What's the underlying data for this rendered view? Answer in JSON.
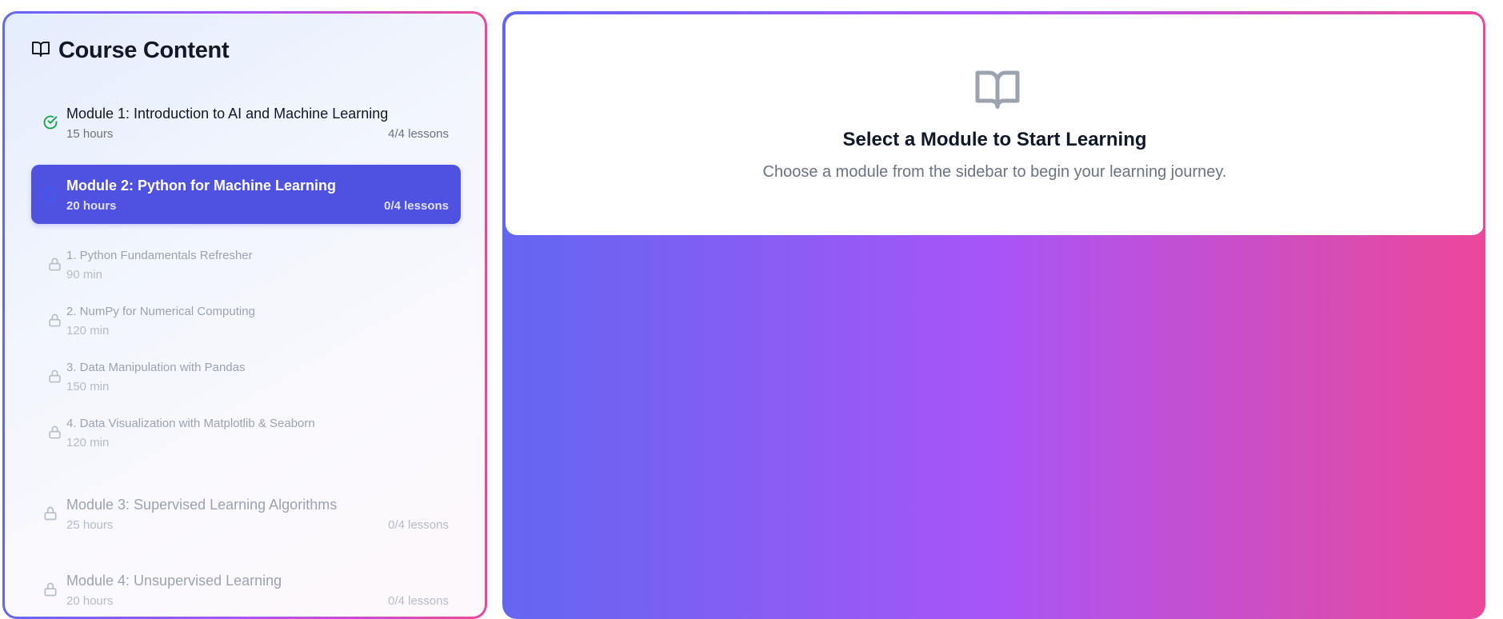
{
  "sidebar": {
    "title": "Course Content",
    "modules": [
      {
        "title": "Module 1: Introduction to AI and Machine Learning",
        "hours": "15 hours",
        "lessons": "4/4 lessons",
        "status": "completed"
      },
      {
        "title": "Module 2: Python for Machine Learning",
        "hours": "20 hours",
        "lessons": "0/4 lessons",
        "status": "active"
      },
      {
        "title": "Module 3: Supervised Learning Algorithms",
        "hours": "25 hours",
        "lessons": "0/4 lessons",
        "status": "locked"
      },
      {
        "title": "Module 4: Unsupervised Learning",
        "hours": "20 hours",
        "lessons": "0/4 lessons",
        "status": "locked"
      }
    ],
    "lessons": [
      {
        "title": "1. Python Fundamentals Refresher",
        "duration": "90 min",
        "icon": "lock-icon"
      },
      {
        "title": "2. NumPy for Numerical Computing",
        "duration": "120 min",
        "icon": "lock-icon"
      },
      {
        "title": "3. Data Manipulation with Pandas",
        "duration": "150 min",
        "icon": "lock-icon"
      },
      {
        "title": "4. Data Visualization with Matplotlib & Seaborn",
        "duration": "120 min",
        "icon": "lock-icon"
      }
    ]
  },
  "main": {
    "welcome_title": "Select a Module to Start Learning",
    "welcome_subtitle": "Choose a module from the sidebar to begin your learning journey.",
    "icon": "book-open-icon"
  },
  "colors": {
    "gradient_start": "#6366f1",
    "gradient_mid": "#a855f7",
    "gradient_end": "#ec4899",
    "active_module": "#4f51e0",
    "completed_check": "#16a34a",
    "text_dark": "#111827",
    "text_muted": "#6b7280",
    "text_locked": "#9ca3af"
  }
}
